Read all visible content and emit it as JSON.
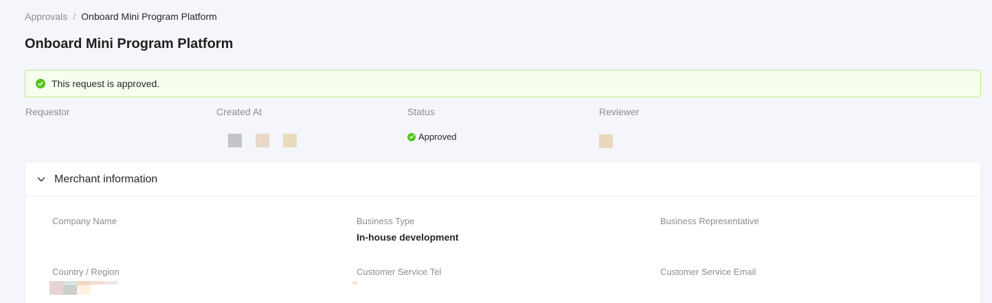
{
  "breadcrumb": {
    "parent": "Approvals",
    "separator": "/",
    "current": "Onboard Mini Program Platform"
  },
  "page_title": "Onboard Mini Program Platform",
  "alert": {
    "text": "This request is approved.",
    "icon": "check-circle-icon",
    "color": "#52c41a"
  },
  "summary": {
    "requestor_label": "Requestor",
    "created_at_label": "Created At",
    "status_label": "Status",
    "status_value": "Approved",
    "reviewer_label": "Reviewer"
  },
  "merchant": {
    "title": "Merchant information",
    "fields": {
      "company_name_label": "Company Name",
      "business_type_label": "Business Type",
      "business_type_value": "In-house development",
      "business_rep_label": "Business Representative",
      "country_label": "Country / Region",
      "cs_tel_label": "Customer Service Tel",
      "cs_email_label": "Customer Service Email"
    }
  },
  "colors": {
    "accent_success": "#52c41a",
    "alert_bg": "#f6ffed",
    "alert_border": "#b7eb8f"
  }
}
